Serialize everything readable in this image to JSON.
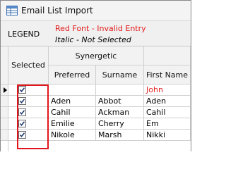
{
  "window": {
    "title": "Email List Import",
    "icon": "envelope-grid-icon"
  },
  "legend": {
    "label": "LEGEND",
    "invalid_text": "Red Font - Invalid Entry",
    "unselected_text": "Italic - Not Selected",
    "invalid_color": "#e21a1a"
  },
  "grid": {
    "group_header": "Synergetic",
    "columns": {
      "selected": "Selected",
      "preferred": "Preferred",
      "surname": "Surname",
      "first_name": "First Name"
    },
    "rows": [
      {
        "selected": true,
        "preferred": "",
        "surname": "",
        "first_name": "John",
        "invalid": true,
        "current": true
      },
      {
        "selected": true,
        "preferred": "Aden",
        "surname": "Abbot",
        "first_name": "Aden"
      },
      {
        "selected": true,
        "preferred": "Cahil",
        "surname": "Ackman",
        "first_name": "Cahil"
      },
      {
        "selected": true,
        "preferred": "Emilie",
        "surname": "Cherry",
        "first_name": "Em"
      },
      {
        "selected": true,
        "preferred": "Nikole",
        "surname": "Marsh",
        "first_name": "Nikki"
      }
    ]
  },
  "highlight_color": "#e0161c"
}
